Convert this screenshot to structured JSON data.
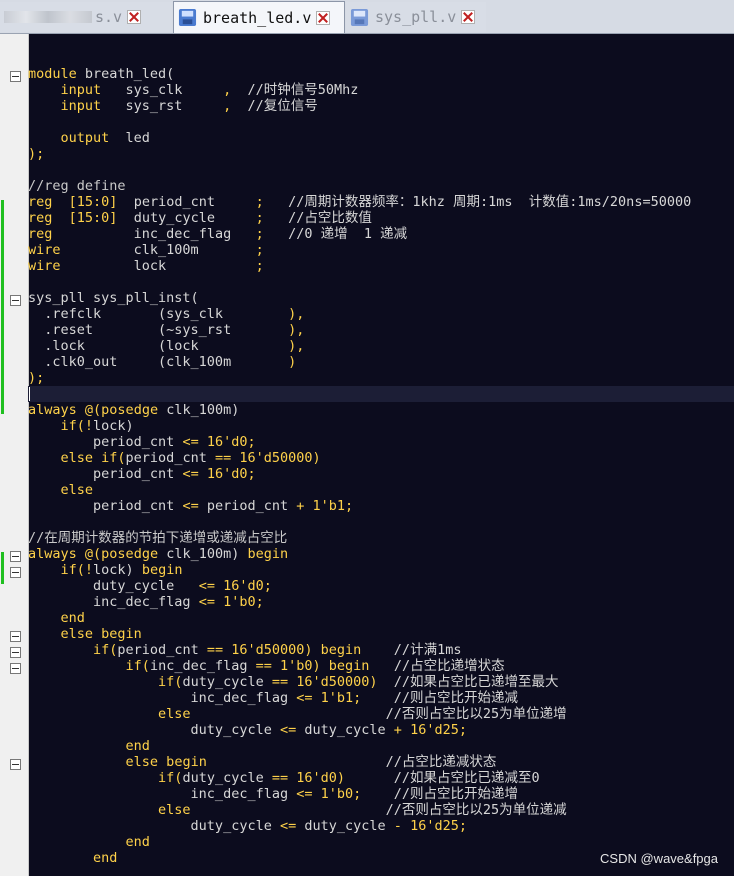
{
  "tabs": [
    {
      "label": "s.v",
      "active": false,
      "blurred": true
    },
    {
      "label": "breath_led.v",
      "active": true
    },
    {
      "label": "sys_pll.v",
      "active": false
    }
  ],
  "code_lines": [
    [],
    [],
    [
      [
        "k",
        "module"
      ],
      [
        "t",
        " breath_led("
      ]
    ],
    [
      [
        "t",
        "    "
      ],
      [
        "k",
        "input"
      ],
      [
        "t",
        "   sys_clk     "
      ],
      [
        "k",
        ","
      ],
      [
        "t",
        "  //时钟信号50Mhz"
      ]
    ],
    [
      [
        "t",
        "    "
      ],
      [
        "k",
        "input"
      ],
      [
        "t",
        "   sys_rst     "
      ],
      [
        "k",
        ","
      ],
      [
        "t",
        "  //复位信号"
      ]
    ],
    [],
    [
      [
        "t",
        "    "
      ],
      [
        "k",
        "output"
      ],
      [
        "t",
        "  led"
      ]
    ],
    [
      [
        "k",
        ");"
      ]
    ],
    [],
    [
      [
        "c",
        "//reg define"
      ]
    ],
    [
      [
        "k",
        "reg"
      ],
      [
        "t",
        "  "
      ],
      [
        "k",
        "[15:0]"
      ],
      [
        "t",
        "  period_cnt     "
      ],
      [
        "k",
        ";"
      ],
      [
        "t",
        "   //周期计数器频率：1khz 周期:1ms  计数值:1ms/20ns=50000"
      ]
    ],
    [
      [
        "k",
        "reg"
      ],
      [
        "t",
        "  "
      ],
      [
        "k",
        "[15:0]"
      ],
      [
        "t",
        "  duty_cycle     "
      ],
      [
        "k",
        ";"
      ],
      [
        "t",
        "   //占空比数值"
      ]
    ],
    [
      [
        "k",
        "reg"
      ],
      [
        "t",
        "          inc_dec_flag   "
      ],
      [
        "k",
        ";"
      ],
      [
        "t",
        "   //0 递增  1 递减"
      ]
    ],
    [
      [
        "k",
        "wire"
      ],
      [
        "t",
        "         clk_100m       "
      ],
      [
        "k",
        ";"
      ]
    ],
    [
      [
        "k",
        "wire"
      ],
      [
        "t",
        "         lock           "
      ],
      [
        "k",
        ";"
      ]
    ],
    [],
    [
      [
        "t",
        "sys_pll sys_pll_inst("
      ]
    ],
    [
      [
        "t",
        "  .refclk       (sys_clk        "
      ],
      [
        "k",
        "),"
      ]
    ],
    [
      [
        "t",
        "  .reset        (~sys_rst       "
      ],
      [
        "k",
        "),"
      ]
    ],
    [
      [
        "t",
        "  .lock         (lock           "
      ],
      [
        "k",
        "),"
      ]
    ],
    [
      [
        "t",
        "  .clk0_out     (clk_100m       "
      ],
      [
        "k",
        ")"
      ]
    ],
    [
      [
        "k",
        ");"
      ]
    ],
    [],
    [
      [
        "k",
        "always"
      ],
      [
        "t",
        " "
      ],
      [
        "k",
        "@(posedge"
      ],
      [
        "t",
        " clk_100m)"
      ]
    ],
    [
      [
        "t",
        "    "
      ],
      [
        "k",
        "if(!"
      ],
      [
        "t",
        "lock)"
      ]
    ],
    [
      [
        "t",
        "        period_cnt "
      ],
      [
        "k",
        "<="
      ],
      [
        "t",
        " "
      ],
      [
        "k",
        "16'd0;"
      ]
    ],
    [
      [
        "t",
        "    "
      ],
      [
        "k",
        "else if("
      ],
      [
        "t",
        "period_cnt "
      ],
      [
        "k",
        "=="
      ],
      [
        "t",
        " "
      ],
      [
        "k",
        "16'd50000)"
      ]
    ],
    [
      [
        "t",
        "        period_cnt "
      ],
      [
        "k",
        "<="
      ],
      [
        "t",
        " "
      ],
      [
        "k",
        "16'd0;"
      ]
    ],
    [
      [
        "t",
        "    "
      ],
      [
        "k",
        "else"
      ]
    ],
    [
      [
        "t",
        "        period_cnt "
      ],
      [
        "k",
        "<="
      ],
      [
        "t",
        " period_cnt "
      ],
      [
        "k",
        "+"
      ],
      [
        "t",
        " "
      ],
      [
        "k",
        "1'b1;"
      ]
    ],
    [],
    [
      [
        "c",
        "//在周期计数器的节拍下递增或递减占空比"
      ]
    ],
    [
      [
        "k",
        "always"
      ],
      [
        "t",
        " "
      ],
      [
        "k",
        "@(posedge"
      ],
      [
        "t",
        " clk_100m) "
      ],
      [
        "k",
        "begin"
      ]
    ],
    [
      [
        "t",
        "    "
      ],
      [
        "k",
        "if(!"
      ],
      [
        "t",
        "lock) "
      ],
      [
        "k",
        "begin"
      ]
    ],
    [
      [
        "t",
        "        duty_cycle   "
      ],
      [
        "k",
        "<="
      ],
      [
        "t",
        " "
      ],
      [
        "k",
        "16'd0;"
      ]
    ],
    [
      [
        "t",
        "        inc_dec_flag "
      ],
      [
        "k",
        "<="
      ],
      [
        "t",
        " "
      ],
      [
        "k",
        "1'b0;"
      ]
    ],
    [
      [
        "t",
        "    "
      ],
      [
        "k",
        "end"
      ]
    ],
    [
      [
        "t",
        "    "
      ],
      [
        "k",
        "else begin"
      ]
    ],
    [
      [
        "t",
        "        "
      ],
      [
        "k",
        "if("
      ],
      [
        "t",
        "period_cnt "
      ],
      [
        "k",
        "=="
      ],
      [
        "t",
        " "
      ],
      [
        "k",
        "16'd50000)"
      ],
      [
        "t",
        " "
      ],
      [
        "k",
        "begin"
      ],
      [
        "t",
        "    //计满1ms"
      ]
    ],
    [
      [
        "t",
        "            "
      ],
      [
        "k",
        "if("
      ],
      [
        "t",
        "inc_dec_flag "
      ],
      [
        "k",
        "=="
      ],
      [
        "t",
        " "
      ],
      [
        "k",
        "1'b0)"
      ],
      [
        "t",
        " "
      ],
      [
        "k",
        "begin"
      ],
      [
        "t",
        "   //占空比递增状态"
      ]
    ],
    [
      [
        "t",
        "                "
      ],
      [
        "k",
        "if("
      ],
      [
        "t",
        "duty_cycle "
      ],
      [
        "k",
        "=="
      ],
      [
        "t",
        " "
      ],
      [
        "k",
        "16'd50000)"
      ],
      [
        "t",
        "  //如果占空比已递增至最大"
      ]
    ],
    [
      [
        "t",
        "                    inc_dec_flag "
      ],
      [
        "k",
        "<="
      ],
      [
        "t",
        " "
      ],
      [
        "k",
        "1'b1;"
      ],
      [
        "t",
        "    //则占空比开始递减"
      ]
    ],
    [
      [
        "t",
        "                "
      ],
      [
        "k",
        "else"
      ],
      [
        "t",
        "                        //否则占空比以25为单位递增"
      ]
    ],
    [
      [
        "t",
        "                    duty_cycle "
      ],
      [
        "k",
        "<="
      ],
      [
        "t",
        " duty_cycle "
      ],
      [
        "k",
        "+"
      ],
      [
        "t",
        " "
      ],
      [
        "k",
        "16'd25;"
      ]
    ],
    [
      [
        "t",
        "            "
      ],
      [
        "k",
        "end"
      ]
    ],
    [
      [
        "t",
        "            "
      ],
      [
        "k",
        "else begin"
      ],
      [
        "t",
        "                      //占空比递减状态"
      ]
    ],
    [
      [
        "t",
        "                "
      ],
      [
        "k",
        "if("
      ],
      [
        "t",
        "duty_cycle "
      ],
      [
        "k",
        "=="
      ],
      [
        "t",
        " "
      ],
      [
        "k",
        "16'd0)"
      ],
      [
        "t",
        "      //如果占空比已递减至0"
      ]
    ],
    [
      [
        "t",
        "                    inc_dec_flag "
      ],
      [
        "k",
        "<="
      ],
      [
        "t",
        " "
      ],
      [
        "k",
        "1'b0;"
      ],
      [
        "t",
        "    //则占空比开始递增"
      ]
    ],
    [
      [
        "t",
        "                "
      ],
      [
        "k",
        "else"
      ],
      [
        "t",
        "                        //否则占空比以25为单位递减"
      ]
    ],
    [
      [
        "t",
        "                    duty_cycle "
      ],
      [
        "k",
        "<="
      ],
      [
        "t",
        " duty_cycle "
      ],
      [
        "k",
        "-"
      ],
      [
        "t",
        " "
      ],
      [
        "k",
        "16'd25;"
      ]
    ],
    [
      [
        "t",
        "            "
      ],
      [
        "k",
        "end"
      ]
    ],
    [
      [
        "t",
        "        "
      ],
      [
        "k",
        "end"
      ]
    ]
  ],
  "watermark": "CSDN @wave&fpga"
}
